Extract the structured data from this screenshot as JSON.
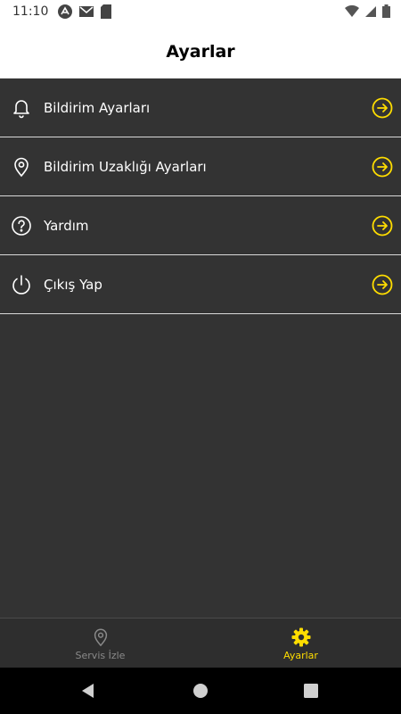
{
  "status_bar": {
    "time": "11:10"
  },
  "header": {
    "title": "Ayarlar"
  },
  "menu": {
    "items": [
      {
        "label": "Bildirim Ayarları",
        "icon": "bell-icon"
      },
      {
        "label": "Bildirim Uzaklığı Ayarları",
        "icon": "location-pin-icon"
      },
      {
        "label": "Yardım",
        "icon": "help-circle-icon"
      },
      {
        "label": "Çıkış Yap",
        "icon": "power-icon"
      }
    ]
  },
  "bottom_nav": {
    "items": [
      {
        "label": "Servis İzle",
        "icon": "location-pin-icon",
        "active": false
      },
      {
        "label": "Ayarlar",
        "icon": "gear-icon",
        "active": true
      }
    ]
  },
  "colors": {
    "accent": "#ffdd00",
    "background": "#333333",
    "header_bg": "#ffffff"
  }
}
